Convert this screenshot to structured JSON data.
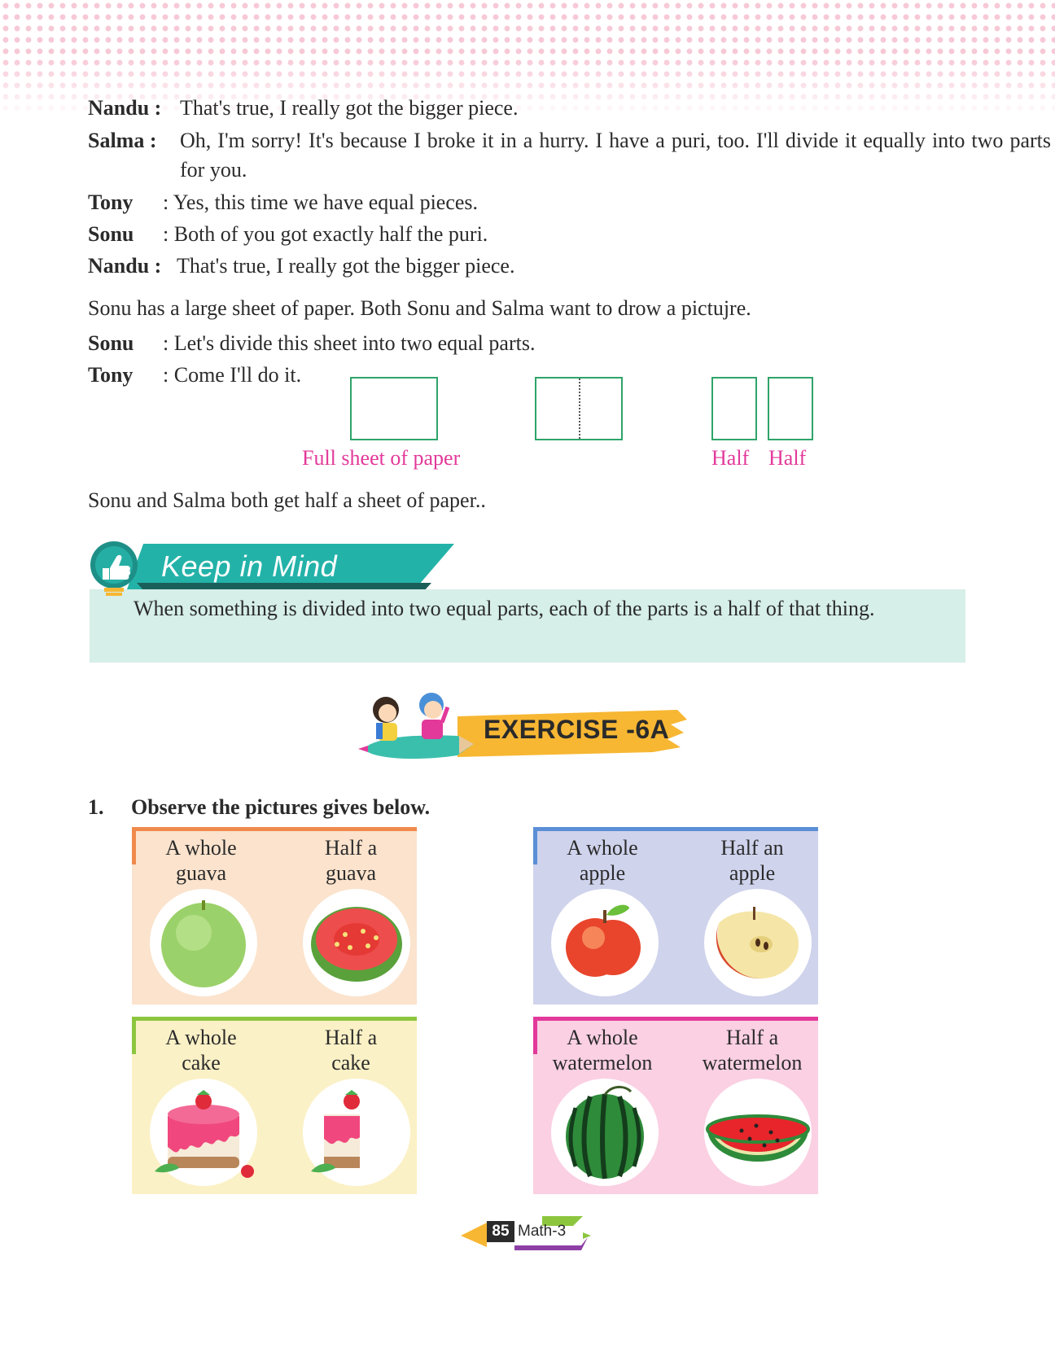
{
  "dialogue": [
    {
      "speaker": "Nandu :",
      "text": "That's true, I really got the bigger piece."
    },
    {
      "speaker": "Salma :",
      "text": "Oh, I'm sorry! It's because I broke it in a hurry. I have a puri, too. I'll divide it equally into two parts for you."
    },
    {
      "speaker": "Tony",
      "text": ": Yes, this time we have equal pieces."
    },
    {
      "speaker": "Sonu",
      "text": ": Both of you got exactly half the puri."
    },
    {
      "speaker": "Nandu :",
      "text": "That's true, I really got the bigger piece."
    }
  ],
  "paragraph1": "Sonu has a large sheet of paper. Both Sonu and Salma want to drow a pictujre.",
  "dialogue2": [
    {
      "speaker": "Sonu",
      "text": ": Let's divide this sheet into two equal parts."
    },
    {
      "speaker": "Tony",
      "text": ": Come I'll do it."
    }
  ],
  "paper_figure": {
    "full_caption": "Full sheet of paper",
    "half_caption_1": "Half",
    "half_caption_2": "Half",
    "border_color": "#2fa46a",
    "caption_color": "#e2399a"
  },
  "paragraph2": "Sonu and Salma both get half a sheet of paper..",
  "keep_in_mind": {
    "title": "Keep in Mind",
    "text": "When something is divided into two equal parts, each of the parts is a half of that thing.",
    "icon": "lightbulb-thumbs-up-icon",
    "box_color": "#d6efe8",
    "banner_color": "#23b2a8"
  },
  "exercise": {
    "title": "EXERCISE -6A",
    "banner_color": "#f7b733"
  },
  "question": {
    "number": "1.",
    "text": "Observe the pictures gives below."
  },
  "cards": [
    {
      "whole_label": [
        "A whole",
        "guava"
      ],
      "half_label": [
        "Half a",
        "guava"
      ],
      "bg": "#fbe3cd",
      "accent": "#f08a4b",
      "fruit": "guava"
    },
    {
      "whole_label": [
        "A whole",
        "apple"
      ],
      "half_label": [
        "Half an",
        "apple"
      ],
      "bg": "#cfd3ec",
      "accent": "#5b8fd6",
      "fruit": "apple"
    },
    {
      "whole_label": [
        "A whole",
        "cake"
      ],
      "half_label": [
        "Half a",
        "cake"
      ],
      "bg": "#fbf1c6",
      "accent": "#8cc63f",
      "fruit": "cake"
    },
    {
      "whole_label": [
        "A whole",
        "watermelon"
      ],
      "half_label": [
        "Half a",
        "watermelon"
      ],
      "bg": "#fbd0e3",
      "accent": "#e2399a",
      "fruit": "watermelon"
    }
  ],
  "footer": {
    "page_number": "85",
    "book": "Math-3"
  }
}
